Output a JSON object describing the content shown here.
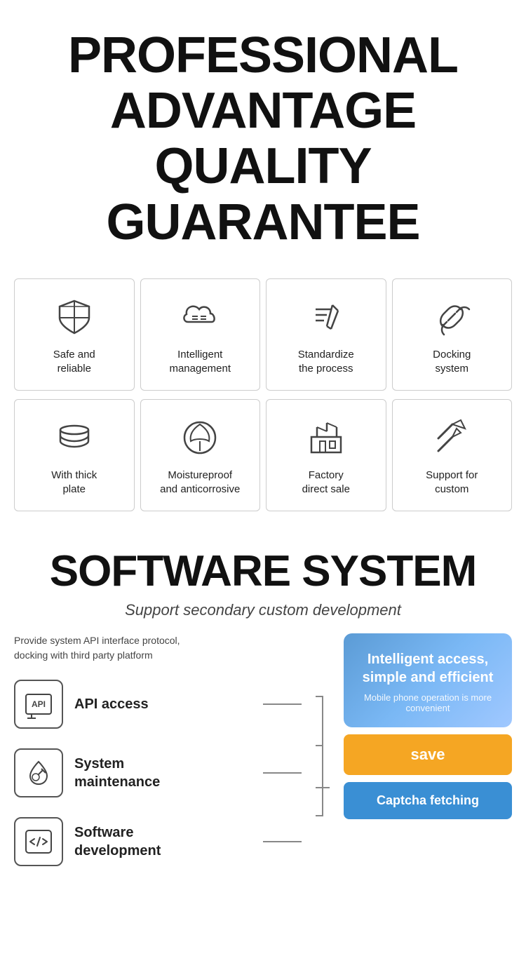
{
  "header": {
    "line1": "PROFESSIONAL",
    "line2": "ADVANTAGE",
    "line3": "QUALITY GUARANTEE"
  },
  "features_row1": [
    {
      "id": "safe-reliable",
      "label": "Safe and\nreliable",
      "icon": "shield"
    },
    {
      "id": "intelligent-management",
      "label": "Intelligent\nmanagement",
      "icon": "cloud-settings"
    },
    {
      "id": "standardize-process",
      "label": "Standardize\nthe process",
      "icon": "pen-ruler"
    },
    {
      "id": "docking-system",
      "label": "Docking\nsystem",
      "icon": "link"
    }
  ],
  "features_row2": [
    {
      "id": "thick-plate",
      "label": "With thick\nplate",
      "icon": "layers"
    },
    {
      "id": "moistureproof",
      "label": "Moistureproof\nand anticorrosive",
      "icon": "shield-leaf"
    },
    {
      "id": "factory-direct",
      "label": "Factory\ndirect sale",
      "icon": "factory"
    },
    {
      "id": "support-custom",
      "label": "Support for\ncustom",
      "icon": "edit-tools"
    }
  ],
  "software": {
    "title": "SOFTWARE SYSTEM",
    "subtitle": "Support secondary custom development",
    "description": "Provide system API interface protocol,\ndocking with third party platform",
    "items": [
      {
        "id": "api-access",
        "label": "API access",
        "icon": "api"
      },
      {
        "id": "system-maintenance",
        "label": "System\nmaintenance",
        "icon": "droplet-wrench"
      },
      {
        "id": "software-development",
        "label": "Software\ndevelopment",
        "icon": "code"
      }
    ],
    "phone_card": {
      "main_text": "Intelligent access,\nsimple and efficient",
      "sub_text": "Mobile phone operation is more\nconvenient"
    },
    "btn_save": "save",
    "btn_captcha": "Captcha fetching"
  }
}
